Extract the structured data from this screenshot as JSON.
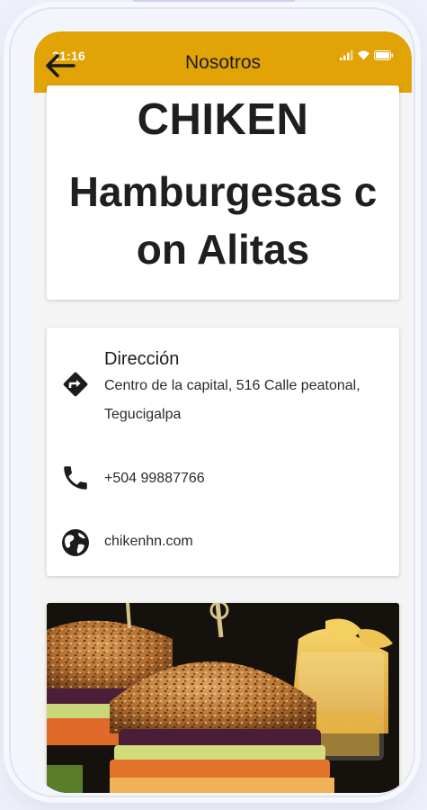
{
  "status_bar": {
    "time": "21:16"
  },
  "appbar": {
    "title": "Nosotros"
  },
  "hero": {
    "name": "CHIKEN",
    "description": "Hamburgesas con Alitas"
  },
  "info": {
    "address": {
      "title": "Dirección",
      "value": "Centro de la capital, 516 Calle peatonal, Tegucigalpa",
      "icon": "directions-icon"
    },
    "phone": {
      "value": "+504 99887766",
      "icon": "phone-icon"
    },
    "website": {
      "value": "chikenhn.com",
      "icon": "globe-icon"
    }
  },
  "colors": {
    "appbar": "#e1a305",
    "text": "#1f1f1f"
  }
}
